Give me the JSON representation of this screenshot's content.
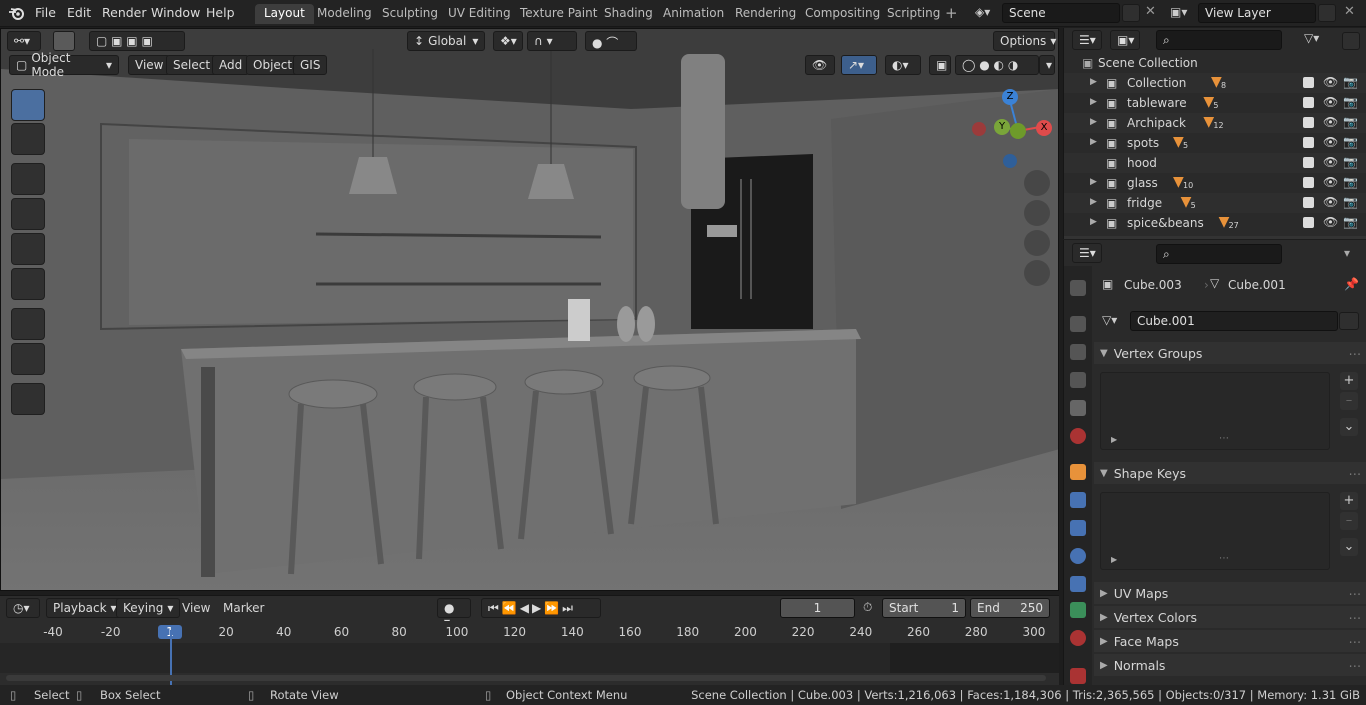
{
  "menus": [
    "File",
    "Edit",
    "Render",
    "Window",
    "Help"
  ],
  "workspaces": [
    {
      "label": "Layout",
      "active": true
    },
    {
      "label": "Modeling"
    },
    {
      "label": "Sculpting"
    },
    {
      "label": "UV Editing"
    },
    {
      "label": "Texture Paint"
    },
    {
      "label": "Shading"
    },
    {
      "label": "Animation"
    },
    {
      "label": "Rendering"
    },
    {
      "label": "Compositing"
    },
    {
      "label": "Scripting"
    }
  ],
  "scene": {
    "name": "Scene",
    "view_layer": "View Layer"
  },
  "viewport": {
    "transform_orientation": "Global",
    "options_label": "Options",
    "mode": "Object Mode",
    "header_menus": [
      "View",
      "Select",
      "Add",
      "Object",
      "GIS"
    ],
    "gizmo": {
      "x": "X",
      "y": "Y",
      "z": "Z"
    },
    "tools": [
      "select-box-icon",
      "cursor-icon",
      "move-icon",
      "rotate-icon",
      "scale-icon",
      "transform-icon",
      "annotate-icon",
      "measure-icon",
      "add-cube-icon"
    ]
  },
  "timeline": {
    "menus": [
      "Playback",
      "Keying",
      "View",
      "Marker"
    ],
    "current_frame": "1",
    "start_label": "Start",
    "start": "1",
    "end_label": "End",
    "end": "250",
    "ruler": [
      "-40",
      "-20",
      "1",
      "20",
      "40",
      "60",
      "80",
      "100",
      "120",
      "140",
      "160",
      "180",
      "200",
      "220",
      "240",
      "260",
      "280",
      "300"
    ],
    "range_end": 250
  },
  "outliner": {
    "root": "Scene Collection",
    "items": [
      {
        "name": "Collection",
        "count": "8",
        "expandable": true
      },
      {
        "name": "tableware",
        "count": "5",
        "expandable": true
      },
      {
        "name": "Archipack",
        "count": "12",
        "expandable": true
      },
      {
        "name": "spots",
        "count": "5",
        "expandable": true
      },
      {
        "name": "hood",
        "count": "",
        "expandable": false
      },
      {
        "name": "glass",
        "count": "10",
        "expandable": true
      },
      {
        "name": "fridge",
        "count": "5",
        "expandable": true
      },
      {
        "name": "spice&beans",
        "count": "27",
        "expandable": true
      }
    ]
  },
  "properties": {
    "object": "Cube.003",
    "mesh": "Cube.001",
    "mesh_field": "Cube.001",
    "panels": {
      "vertex_groups": "Vertex Groups",
      "shape_keys": "Shape Keys",
      "uv_maps": "UV Maps",
      "vertex_colors": "Vertex Colors",
      "face_maps": "Face Maps",
      "normals": "Normals"
    }
  },
  "statusbar": {
    "select": "Select",
    "box_select": "Box Select",
    "rotate_view": "Rotate View",
    "context_menu": "Object Context Menu",
    "stats": "Scene Collection | Cube.003 | Verts:1,216,063 | Faces:1,184,306 | Tris:2,365,565 | Objects:0/317 | Memory: 1.31 GiB"
  },
  "colors": {
    "accent": "#4772b3",
    "orange": "#e8923a",
    "active_tool": "#4b6fa0",
    "x_axis": "#e04b4b",
    "y_axis": "#7aa53a",
    "z_axis": "#3b82d6"
  }
}
